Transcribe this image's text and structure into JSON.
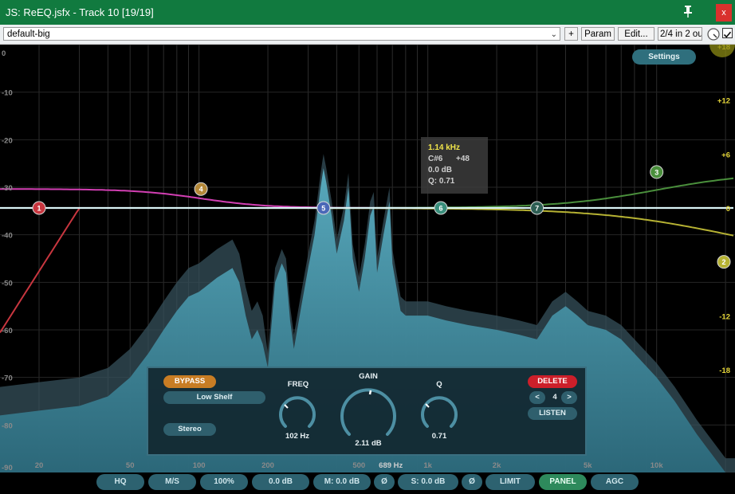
{
  "window": {
    "title": "JS: ReEQ.jsfx - Track 10 [19/19]",
    "close_label": "x"
  },
  "toolbar": {
    "preset": "default-big",
    "plus": "+",
    "param": "Param",
    "edit": "Edit...",
    "io": "2/4 in 2 ou"
  },
  "axes": {
    "left_db": [
      "0",
      "-10",
      "-20",
      "-30",
      "-40",
      "-50",
      "-60",
      "-70",
      "-80",
      "-90"
    ],
    "right_db": [
      "+18",
      "+12",
      "+6",
      "0",
      "-6",
      "-12",
      "-18"
    ],
    "freq": [
      "20",
      "50",
      "100",
      "200",
      "500",
      "689 Hz",
      "1k",
      "2k",
      "5k",
      "10k"
    ]
  },
  "colors": {
    "accent": "#4f9fb2",
    "spectrum": "#4a98ad",
    "bypass": "#c87d24",
    "delete": "#cc1f2a",
    "panel_on": "#2e8a5c",
    "tooltip_freq": "#f0e44a",
    "gain_axis": "#e6d73a"
  },
  "settings_label": "Settings",
  "tooltip": {
    "freq": "1.14 kHz",
    "note": "C#6",
    "cents": "+48",
    "gain": "0.0 dB",
    "q": "Q: 0.71"
  },
  "bands": [
    {
      "num": "1",
      "freq_hz": 20,
      "gain_db": 0,
      "type": "high-pass",
      "color": "#c8363f"
    },
    {
      "num": "2",
      "freq_hz": 21000,
      "gain_db": -6,
      "type": "high-shelf",
      "color": "#b6b233"
    },
    {
      "num": "3",
      "freq_hz": 10000,
      "gain_db": 4,
      "type": "high-shelf",
      "color": "#4a8f3c"
    },
    {
      "num": "4",
      "freq_hz": 102,
      "gain_db": 2.11,
      "type": "low-shelf",
      "color": "#b48838"
    },
    {
      "num": "5",
      "freq_hz": 350,
      "gain_db": 0,
      "type": "bell",
      "color": "#4a68b8"
    },
    {
      "num": "6",
      "freq_hz": 1140,
      "gain_db": 0,
      "type": "bell",
      "color": "#3a8f7c"
    },
    {
      "num": "7",
      "freq_hz": 3000,
      "gain_db": 0,
      "type": "bell",
      "color": "#2e5f54"
    }
  ],
  "panel": {
    "bypass": "BYPASS",
    "filter_type": "Low Shelf",
    "stereo": "Stereo",
    "freq_label": "FREQ",
    "freq_value": "102 Hz",
    "gain_label": "GAIN",
    "gain_value": "2.11 dB",
    "q_label": "Q",
    "q_value": "0.71",
    "delete": "DELETE",
    "prev": "<",
    "band_num": "4",
    "next": ">",
    "listen": "LISTEN"
  },
  "bottom": {
    "hq": "HQ",
    "ms": "M/S",
    "zoom": "100%",
    "gain": "0.0 dB",
    "mid": "M: 0.0 dB",
    "phase1": "Ø",
    "side": "S: 0.0 dB",
    "phase2": "Ø",
    "limit": "LIMIT",
    "panel": "PANEL",
    "agc": "AGC"
  }
}
